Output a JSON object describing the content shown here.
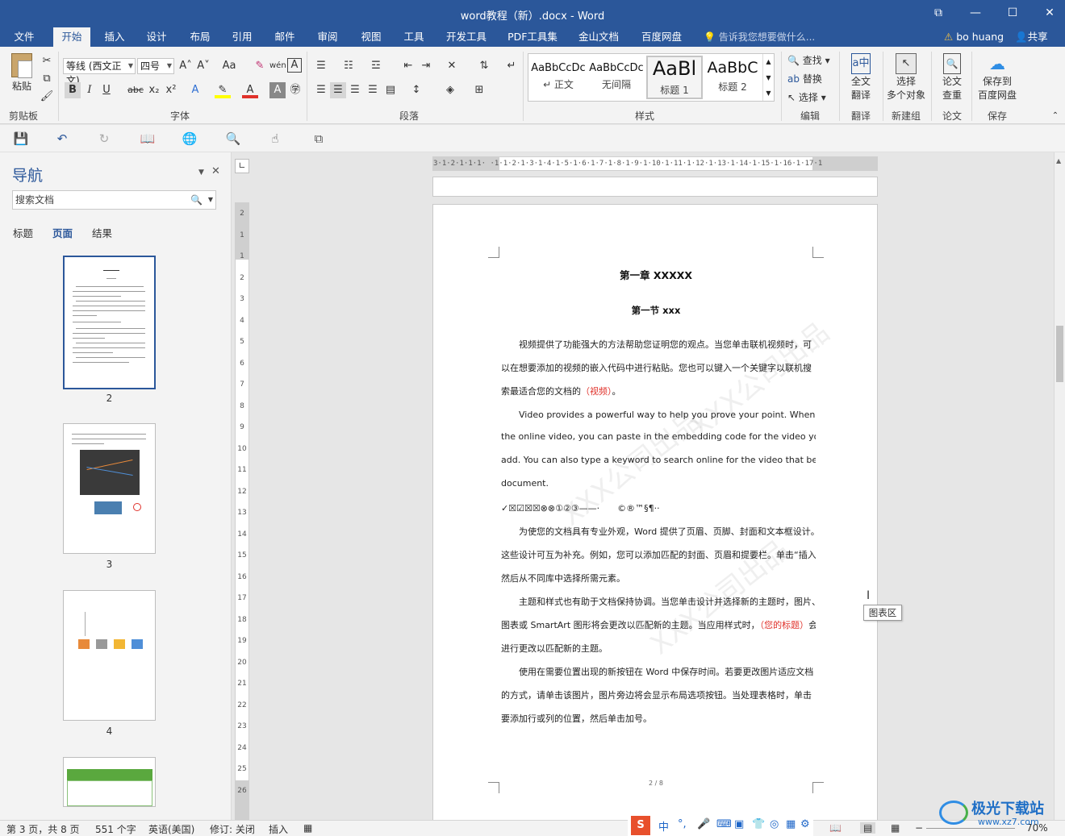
{
  "window": {
    "title": "word教程（新）.docx - Word",
    "controls": [
      "⧉",
      "—",
      "☐",
      "✕"
    ]
  },
  "tabs": [
    "文件",
    "开始",
    "插入",
    "设计",
    "布局",
    "引用",
    "邮件",
    "审阅",
    "视图",
    "工具",
    "开发工具",
    "PDF工具集",
    "金山文档",
    "百度网盘"
  ],
  "active_tab": "开始",
  "tell_me": "告诉我您想要做什么...",
  "user": "bo huang",
  "share": "共享",
  "ribbon": {
    "clipboard": {
      "paste": "粘贴",
      "label": "剪贴板"
    },
    "font": {
      "font_name": "等线 (西文正文)",
      "font_size": "四号",
      "label": "字体",
      "bold": "B",
      "italic": "I",
      "underline": "U",
      "strike": "abc",
      "sub": "x₂",
      "sup": "x²",
      "grow": "A˄",
      "shrink": "A˅",
      "case": "Aa",
      "font_color": "#e0312a",
      "highlight_color": "#ffff00"
    },
    "paragraph": {
      "label": "段落"
    },
    "styles": {
      "label": "样式",
      "items": [
        {
          "preview": "AaBbCcDc",
          "name": "↵ 正文"
        },
        {
          "preview": "AaBbCcDc",
          "name": "无间隔"
        },
        {
          "preview": "AaBl",
          "name": "标题 1"
        },
        {
          "preview": "AaBbC",
          "name": "标题 2"
        }
      ]
    },
    "editing": {
      "find": "查找",
      "replace": "替换",
      "select": "选择",
      "label": "编辑"
    },
    "translate": {
      "line1": "全文",
      "line2": "翻译",
      "label": "翻译"
    },
    "newgroup": {
      "line1": "选择",
      "line2": "多个对象",
      "label": "新建组"
    },
    "paper": {
      "line1": "论文",
      "line2": "查重",
      "label": "论文"
    },
    "save": {
      "line1": "保存到",
      "line2": "百度网盘",
      "label": "保存"
    }
  },
  "navigation": {
    "title": "导航",
    "search_placeholder": "搜索文档",
    "tabs": [
      "标题",
      "页面",
      "结果"
    ],
    "active_tab": "页面",
    "pages": [
      "2",
      "3",
      "4"
    ]
  },
  "ruler": {
    "horizontal": "3·1·2·1·1·1· ·1·1·2·1·3·1·4·1·5·1·6·1·7·1·8·1·9·1·10·1·11·1·12·1·13·1·14·1·15·1·16·1·17·1",
    "vertical": [
      "2",
      "1",
      "1",
      "2",
      "3",
      "4",
      "5",
      "6",
      "7",
      "8",
      "9",
      "10",
      "11",
      "12",
      "13",
      "14",
      "15",
      "16",
      "17",
      "18",
      "19",
      "20",
      "21",
      "22",
      "23",
      "24",
      "25",
      "26"
    ]
  },
  "document": {
    "heading1": "第一章 XXXXX",
    "heading2": "第一节 xxx",
    "lines": [
      {
        "text": "　　视频提供了功能强大的方法帮助您证明您的观点。当您单击联机视频时，可"
      },
      {
        "text": "以在想要添加的视频的嵌入代码中进行粘贴。您也可以键入一个关键字以联机搜"
      },
      {
        "text": "索最适合您的文档的",
        "red": "（视频）",
        "after": "。"
      },
      {
        "text": "　　Video provides a powerful way to help you prove your point. When you click"
      },
      {
        "text": "the online video, you can paste in the embedding code for the video you want to"
      },
      {
        "text": "add. You can also type a keyword to search online for the video that best fits your"
      },
      {
        "text": "document."
      },
      {
        "text": "✓☒☑☒☒⊗⊗①②③——·　　©®™§¶··"
      },
      {
        "text": "　　为使您的文档具有专业外观，Word 提供了页眉、页脚、封面和文本框设计。"
      },
      {
        "text": "这些设计可互为补充。例如，您可以添加匹配的封面、页眉和提要栏。单击“插入”，"
      },
      {
        "text": "然后从不同库中选择所需元素。"
      },
      {
        "text": "　　主题和样式也有助于文档保持协调。当您单击设计并选择新的主题时，图片、"
      },
      {
        "text": "图表或 SmartArt 图形将会更改以匹配新的主题。当应用样式时，",
        "red": "（您的标题）",
        "after": "会"
      },
      {
        "text": "进行更改以匹配新的主题。"
      },
      {
        "text": "　　使用在需要位置出现的新按钮在 Word 中保存时间。若要更改图片适应文档"
      },
      {
        "text": "的方式，请单击该图片，图片旁边将会显示布局选项按钮。当处理表格时，单击"
      },
      {
        "text": "要添加行或列的位置，然后单击加号。"
      }
    ],
    "page_number": "2 / 8",
    "watermark": "XXX公司出品",
    "tooltip": "图表区"
  },
  "status": {
    "page": "第 3 页，共 8 页",
    "words": "551 个字",
    "language": "英语(美国)",
    "track": "修订: 关闭",
    "mode": "插入",
    "zoom": "70%"
  },
  "ime": [
    "S",
    "中",
    "°,",
    "🎤",
    "⌨",
    "▣",
    "👕",
    "◎",
    "▦",
    "⚙"
  ],
  "brand": {
    "name": "极光下载站",
    "url": "www.xz7.com"
  }
}
